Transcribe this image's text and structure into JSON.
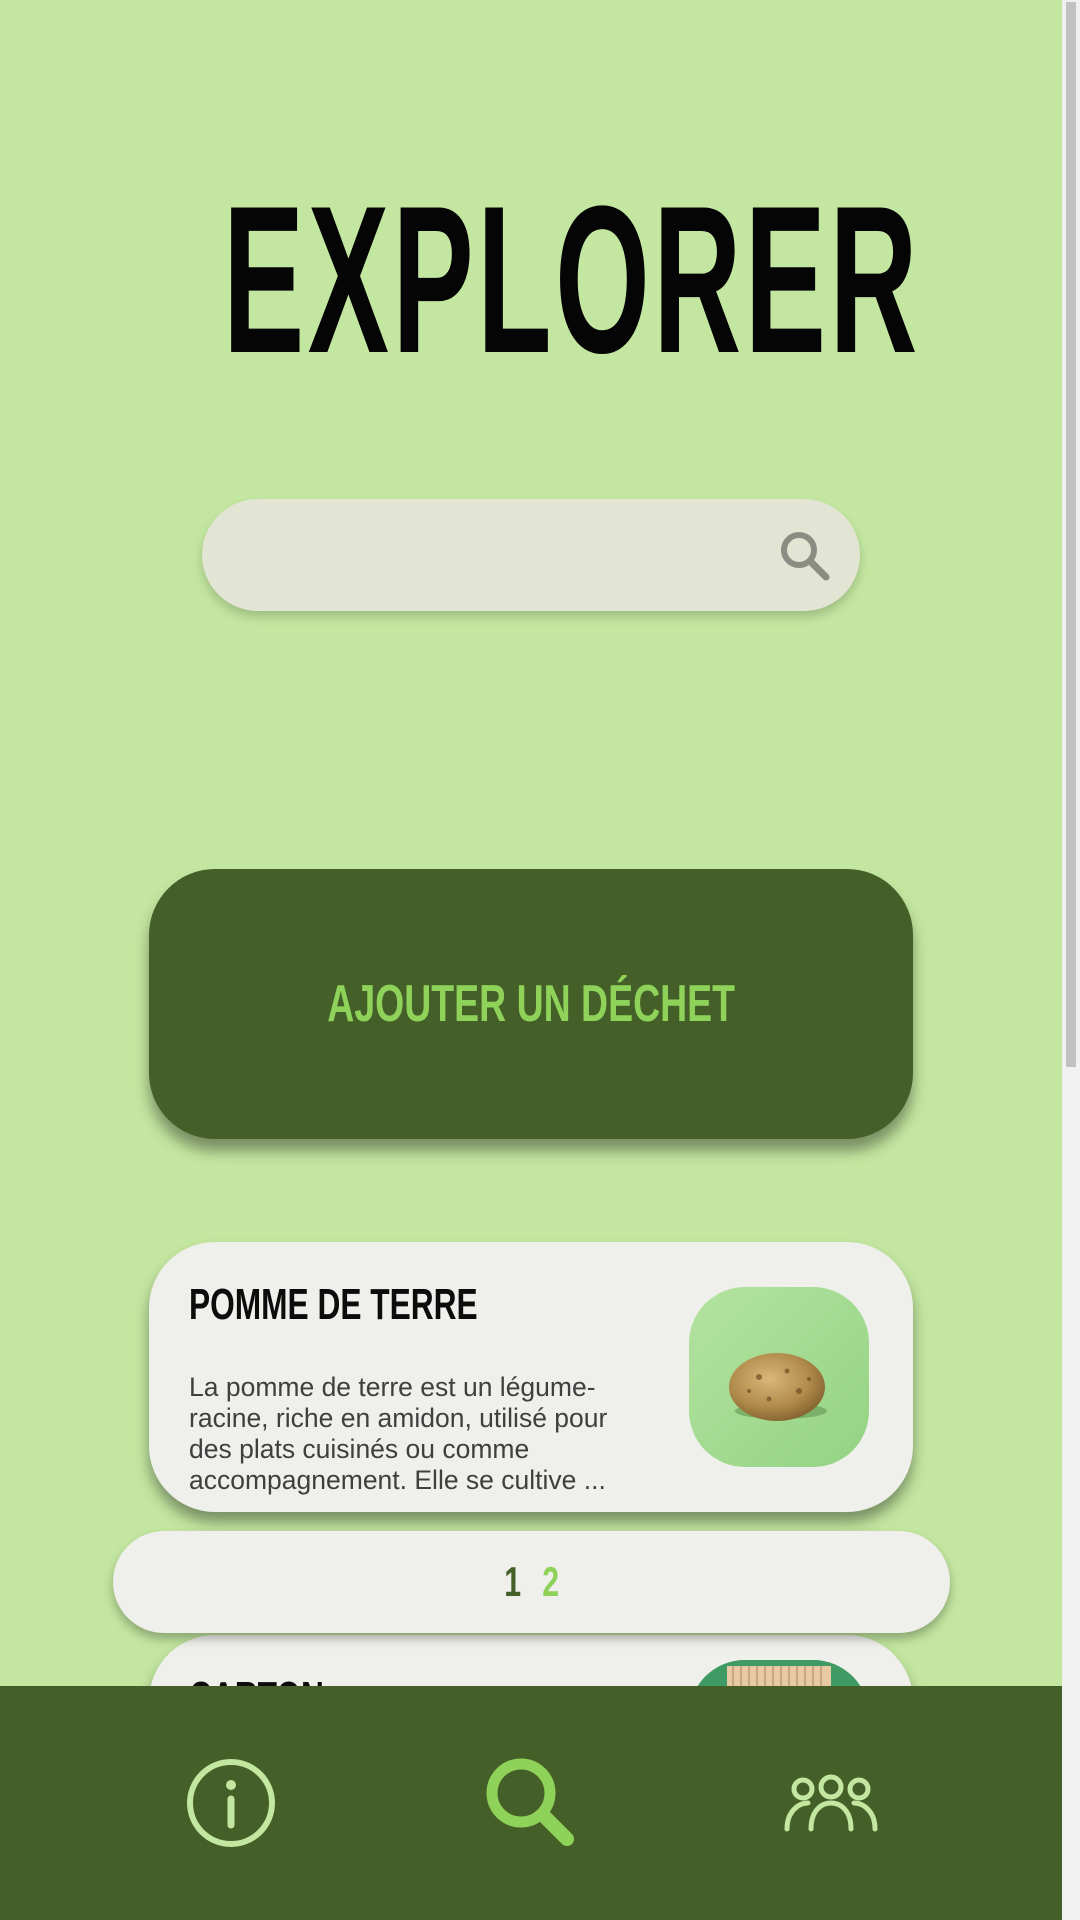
{
  "header": {
    "title": "EXPLORER"
  },
  "search": {
    "value": "",
    "placeholder": "",
    "icon": "search-icon"
  },
  "actions": {
    "add_waste_label": "AJOUTER UN DÉCHET"
  },
  "items": [
    {
      "title": "POMME DE TERRE",
      "description": "La pomme de terre est un légume-racine, riche en amidon, utilisé pour des plats cuisinés ou comme accompagnement. Elle se cultive ...",
      "image": "potato-image"
    },
    {
      "title": "CARTON",
      "description": "",
      "image": "cardboard-image"
    }
  ],
  "pagination": {
    "pages": [
      "1",
      "2"
    ],
    "current": "1"
  },
  "bottom_nav": [
    {
      "icon": "info-icon",
      "active": false
    },
    {
      "icon": "search-icon",
      "active": true
    },
    {
      "icon": "community-icon",
      "active": false
    }
  ],
  "colors": {
    "background": "#c3e7a0",
    "primary_dark": "#445f27",
    "accent_green": "#8ed25a",
    "card_bg": "#efefeb",
    "search_bg": "#e2e5d4"
  }
}
